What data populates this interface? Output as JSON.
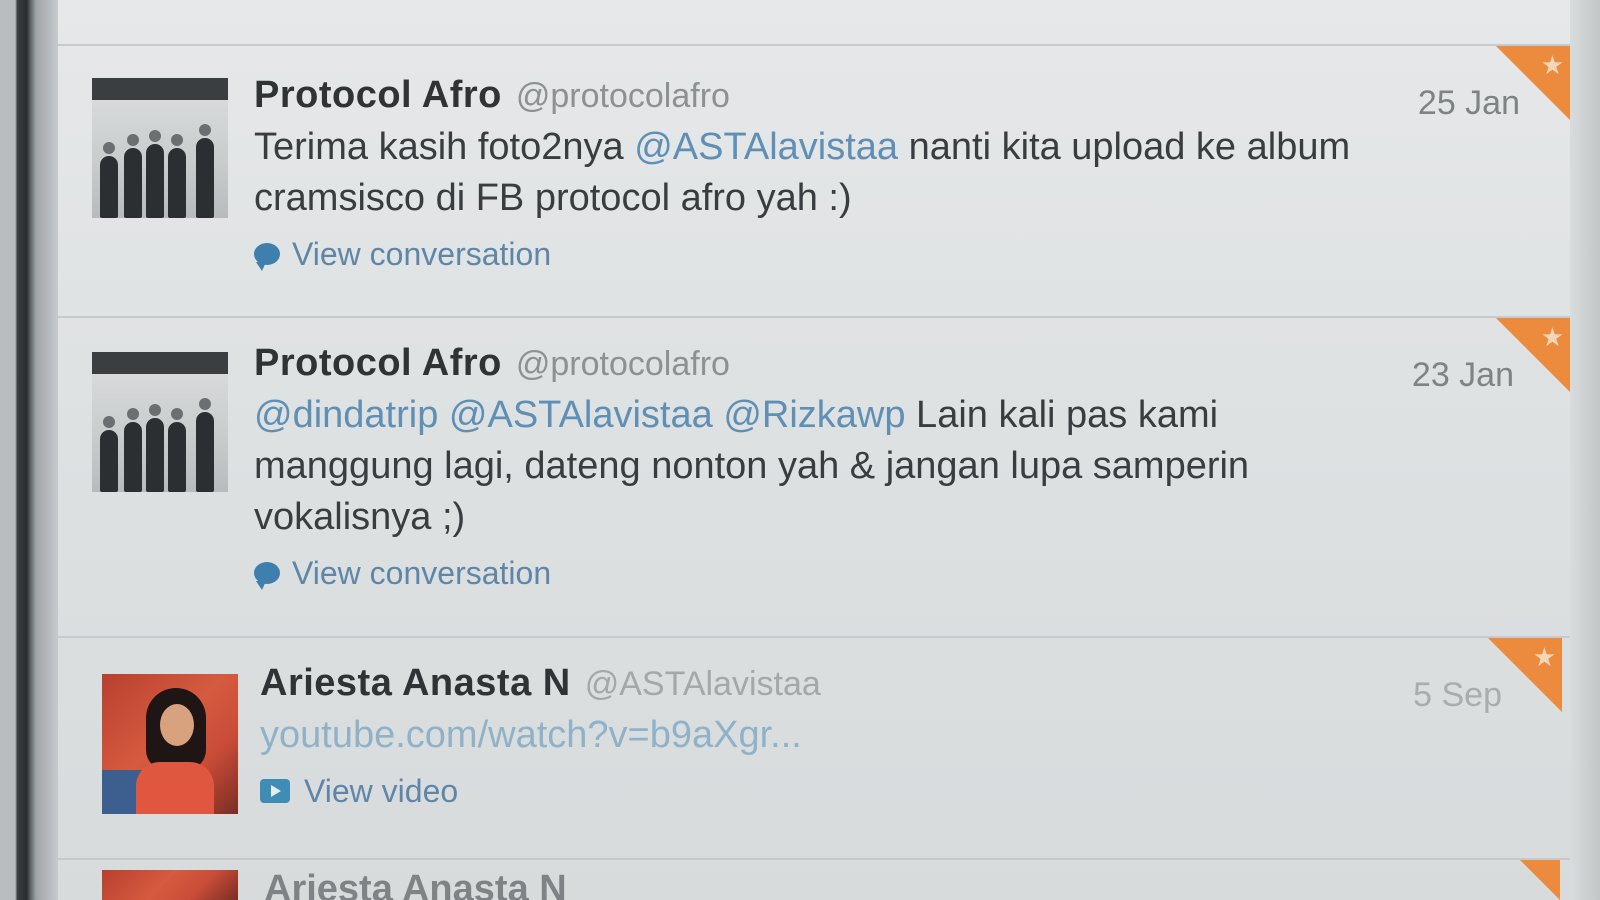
{
  "tweets": [
    {
      "name": "Protocol Afro",
      "handle": "@protocolafro",
      "date": "25 Jan",
      "text_parts": {
        "t1": "Terima kasih foto2nya ",
        "m1": "@ASTAlavistaa",
        "t2": " nanti kita upload ke album cramsisco di FB protocol afro yah :)"
      },
      "action_label": "View conversation",
      "action_icon": "speech-bubble-icon",
      "favorited": true
    },
    {
      "name": "Protocol Afro",
      "handle": "@protocolafro",
      "date": "23 Jan",
      "text_parts": {
        "m1": "@dindatrip",
        "m2": "@ASTAlavistaa",
        "m3": "@Rizkawp",
        "t1": " Lain kali pas kami manggung lagi, dateng nonton yah & jangan lupa samperin vokalisnya ;)"
      },
      "action_label": "View conversation",
      "action_icon": "speech-bubble-icon",
      "favorited": true
    },
    {
      "name": "Ariesta Anasta N",
      "handle": "@ASTAlavistaa",
      "date": "5 Sep",
      "link": "youtube.com/watch?v=b9aXgr...",
      "action_label": "View video",
      "action_icon": "video-play-icon",
      "favorited": true
    },
    {
      "name": "Ariesta Anasta N",
      "favorited": true
    }
  ],
  "colors": {
    "favorite_corner": "#ec8a3d",
    "mention": "#5f8fb4",
    "name": "#303335",
    "handle": "#8d9194"
  }
}
